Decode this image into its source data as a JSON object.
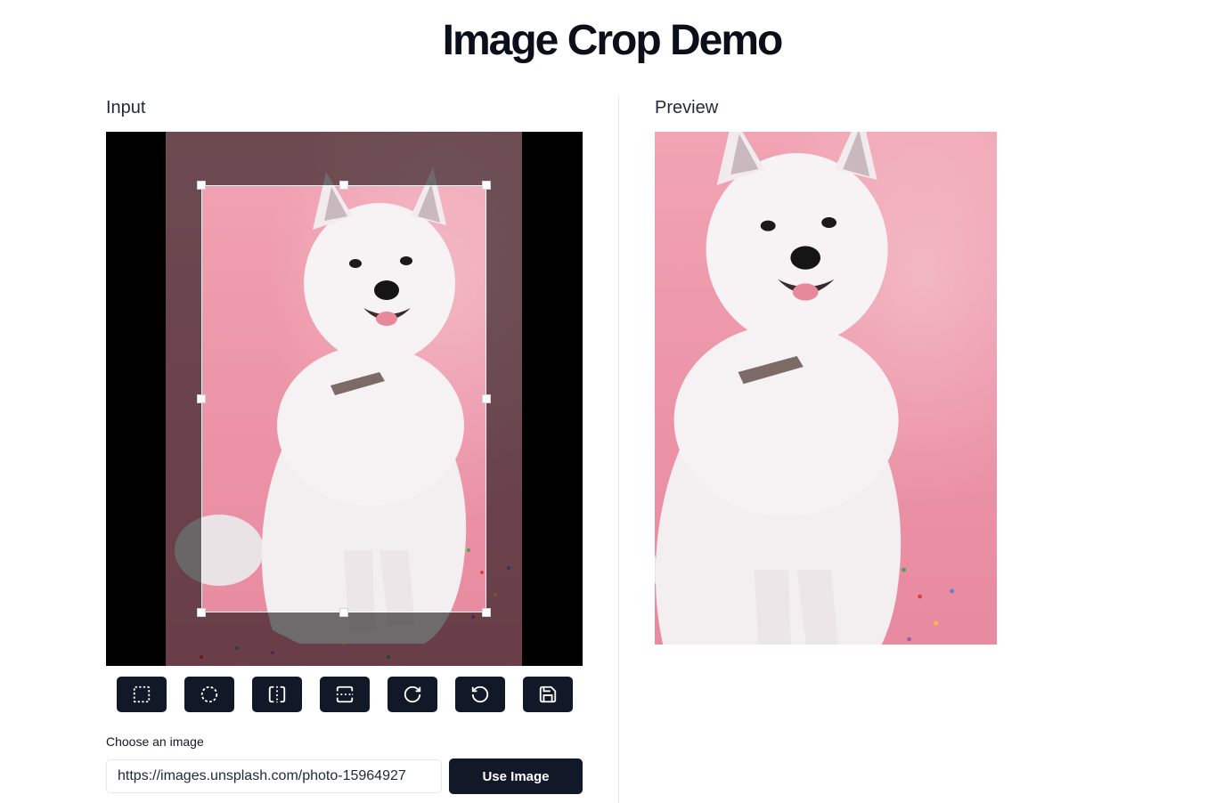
{
  "page": {
    "title": "Image Crop Demo"
  },
  "input_panel": {
    "label": "Input",
    "image_description_icon": "dog-photo",
    "crop_handles": [
      "top-left",
      "top",
      "top-right",
      "left",
      "right",
      "bottom-left",
      "bottom",
      "bottom-right"
    ]
  },
  "toolbar": {
    "buttons": [
      {
        "id": "rect-select",
        "icon": "rectangle-select-icon"
      },
      {
        "id": "circle-select",
        "icon": "circle-select-icon"
      },
      {
        "id": "flip-horizontal",
        "icon": "flip-horizontal-icon"
      },
      {
        "id": "flip-vertical",
        "icon": "flip-vertical-icon"
      },
      {
        "id": "rotate-right",
        "icon": "rotate-cw-icon"
      },
      {
        "id": "rotate-left",
        "icon": "rotate-ccw-icon"
      },
      {
        "id": "save",
        "icon": "save-icon"
      }
    ]
  },
  "chooser": {
    "label": "Choose an image",
    "url_value": "https://images.unsplash.com/photo-15964927",
    "use_button": "Use Image"
  },
  "preview_panel": {
    "label": "Preview"
  },
  "colors": {
    "dark_button": "#111827",
    "photo_background": "#ec93a7",
    "divider": "#e5e7eb"
  }
}
